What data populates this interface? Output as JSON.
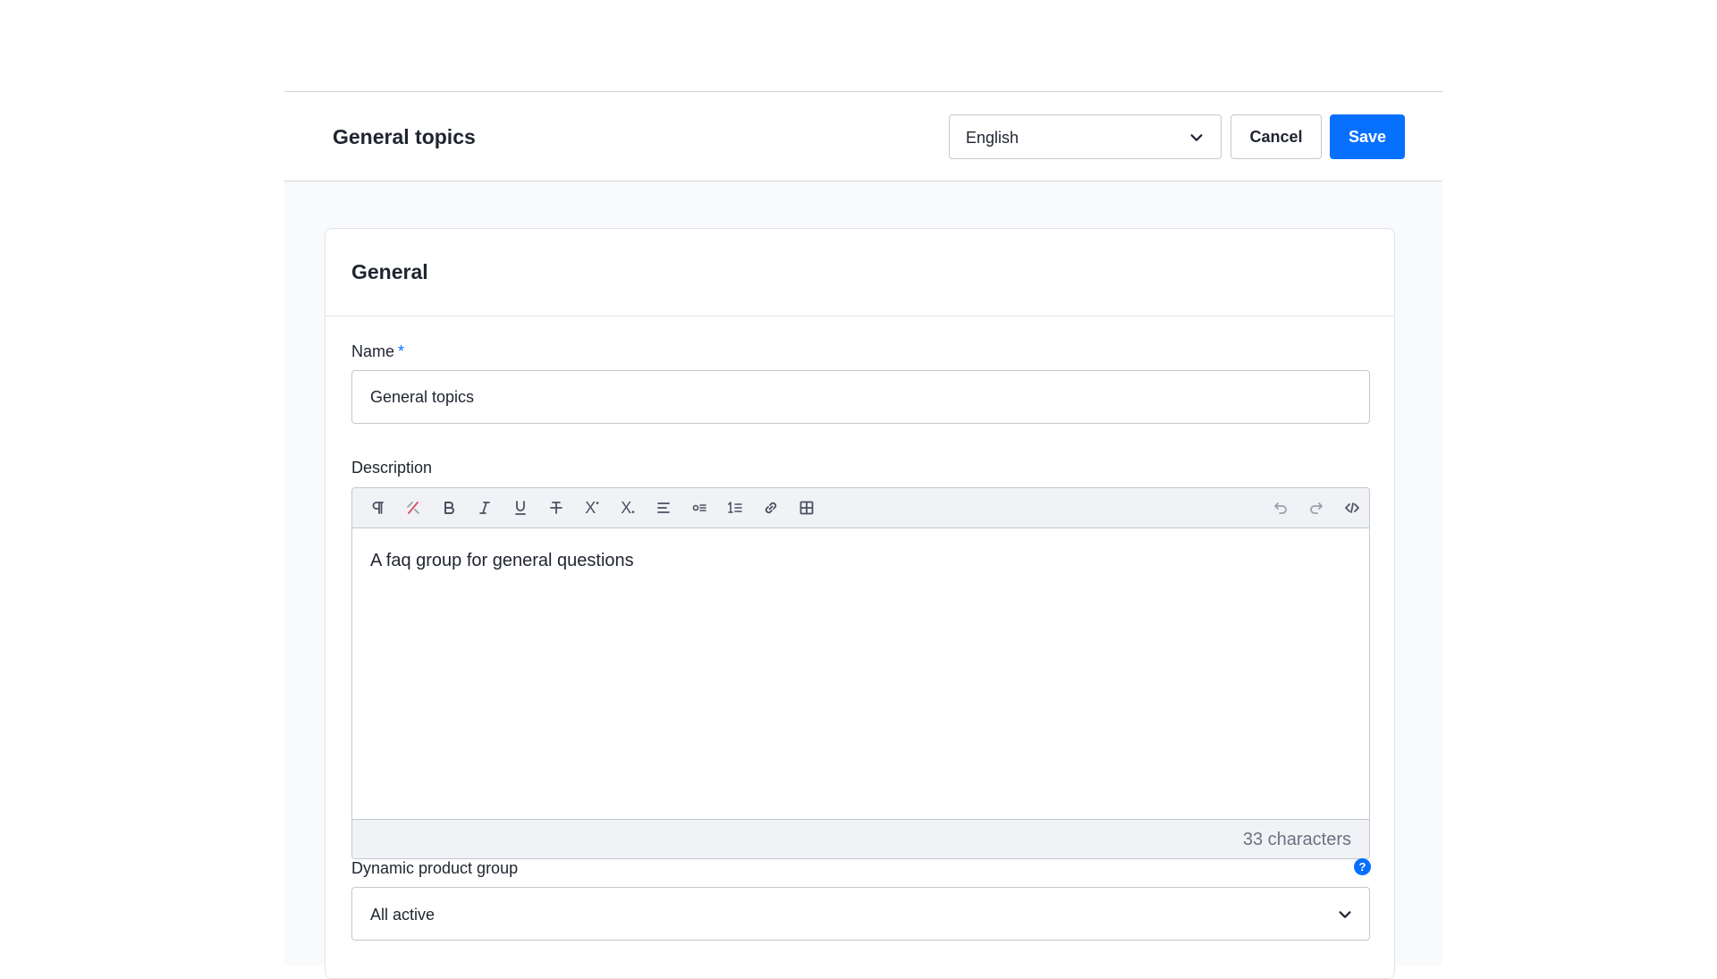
{
  "header": {
    "title": "General topics",
    "language": "English",
    "cancel_label": "Cancel",
    "save_label": "Save"
  },
  "card": {
    "title": "General",
    "name_label": "Name",
    "name_required_mark": "*",
    "name_value": "General topics",
    "description_label": "Description",
    "description_text": "A faq group for general questions",
    "char_count": "33 characters",
    "toolbar": {
      "superscript_glyph": "X",
      "subscript_glyph": "X"
    },
    "dynamic_group_label": "Dynamic product group",
    "help_glyph": "?",
    "dynamic_group_value": "All active"
  },
  "colors": {
    "primary": "#0870ff",
    "border": "#c3c8d0",
    "toolbar_bg": "#f0f2f6",
    "clear_format_accent": "#e04a5f"
  },
  "icons": [
    "paragraph-icon",
    "clear-format-icon",
    "bold-icon",
    "italic-icon",
    "underline-icon",
    "strikethrough-icon",
    "superscript-icon",
    "subscript-icon",
    "align-icon",
    "bullet-list-icon",
    "numbered-list-icon",
    "link-icon",
    "table-icon",
    "undo-icon",
    "redo-icon",
    "code-view-icon",
    "chevron-down-icon",
    "help-icon"
  ]
}
